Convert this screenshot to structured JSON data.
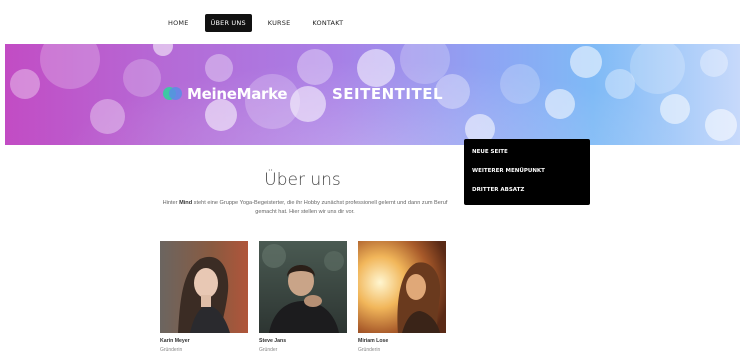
{
  "nav": {
    "items": [
      {
        "label": "HOME"
      },
      {
        "label": "ÜBER UNS"
      },
      {
        "label": "KURSE"
      },
      {
        "label": "KONTAKT"
      }
    ]
  },
  "hero": {
    "brand": "MeineMarke",
    "title": "SEITENTITEL"
  },
  "dropdown": {
    "items": [
      {
        "label": "NEUE SEITE"
      },
      {
        "label": "WEITERER MENÜPUNKT"
      },
      {
        "label": "DRITTER ABSATZ"
      }
    ]
  },
  "main": {
    "title": "Über uns",
    "intro_before": "Hinter ",
    "intro_bold": "Mind",
    "intro_after": " steht eine Gruppe Yoga-Begeisterter, die ihr Hobby zunächst professionell gelernt und dann zum Beruf gemacht hat. Hier stellen wir uns dir vor."
  },
  "team": [
    {
      "name": "Karin Meyer",
      "role": "Gründerin"
    },
    {
      "name": "Steve Jans",
      "role": "Gründer"
    },
    {
      "name": "Miriam Lose",
      "role": "Gründerin"
    }
  ],
  "colors": {
    "nav_active_bg": "#111111",
    "dropdown_bg": "#000000",
    "hero_left": "#c24cc4",
    "hero_right": "#c7d9fb",
    "logo_green": "#3fc7a4",
    "logo_blue": "#5a8ce8"
  },
  "icons": {
    "logo": "brand-logo-icon"
  }
}
